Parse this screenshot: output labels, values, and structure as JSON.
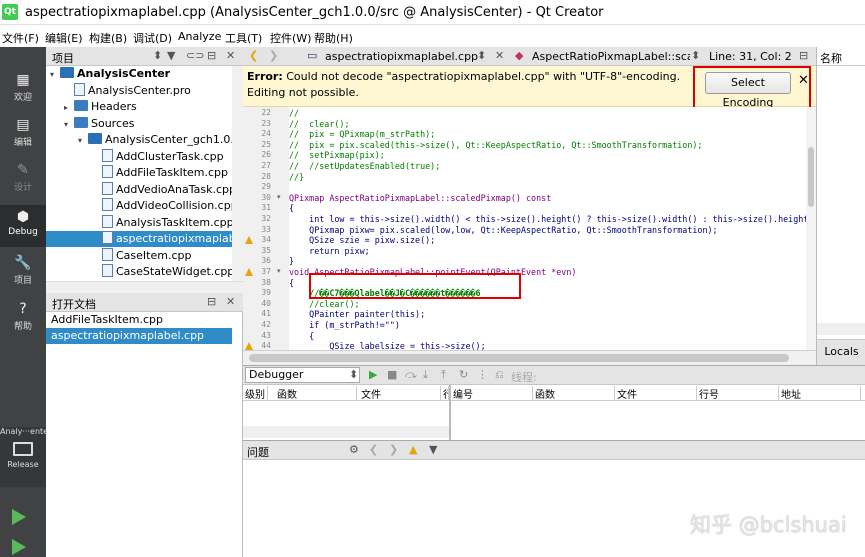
{
  "window": {
    "title": "aspectratiopixmaplabel.cpp (AnalysisCenter_gch1.0.0/src @ AnalysisCenter) - Qt Creator",
    "qt_logo": "Qt"
  },
  "menu": [
    "文件(F)",
    "编辑(E)",
    "构建(B)",
    "调试(D)",
    "Analyze",
    "工具(T)",
    "控件(W)",
    "帮助(H)"
  ],
  "modes": [
    {
      "label": "欢迎",
      "icon": "welcome-icon",
      "glyph": "▦"
    },
    {
      "label": "编辑",
      "icon": "edit-icon",
      "glyph": "▤"
    },
    {
      "label": "设计",
      "icon": "design-icon",
      "glyph": "✎"
    },
    {
      "label": "Debug",
      "icon": "debug-icon",
      "glyph": "⬢"
    },
    {
      "label": "项目",
      "icon": "projects-icon",
      "glyph": "🔧"
    },
    {
      "label": "帮助",
      "icon": "help-icon",
      "glyph": "?"
    }
  ],
  "kit": {
    "project": "Analy···enter",
    "config": "Release",
    "run_icon": "run-icon",
    "debug_run_icon": "debug-run-icon"
  },
  "project_pane": {
    "title": "项目",
    "tree": [
      {
        "label": "AnalysisCenter",
        "depth": 0,
        "kind": "project",
        "arrow": "▾"
      },
      {
        "label": "AnalysisCenter.pro",
        "depth": 1,
        "kind": "file",
        "arrow": ""
      },
      {
        "label": "Headers",
        "depth": 1,
        "kind": "folder",
        "arrow": "▸"
      },
      {
        "label": "Sources",
        "depth": 1,
        "kind": "folder",
        "arrow": "▾"
      },
      {
        "label": "AnalysisCenter_gch1.0.0/s",
        "depth": 2,
        "kind": "project",
        "arrow": "▾"
      },
      {
        "label": "AddClusterTask.cpp",
        "depth": 3,
        "kind": "file",
        "arrow": ""
      },
      {
        "label": "AddFileTaskItem.cpp",
        "depth": 3,
        "kind": "file",
        "arrow": ""
      },
      {
        "label": "AddVedioAnaTask.cpp",
        "depth": 3,
        "kind": "file",
        "arrow": ""
      },
      {
        "label": "AddVideoCollision.cpp",
        "depth": 3,
        "kind": "file",
        "arrow": ""
      },
      {
        "label": "AnalysisTaskItem.cpp",
        "depth": 3,
        "kind": "file",
        "arrow": ""
      },
      {
        "label": "aspectratiopixmaplabe",
        "depth": 3,
        "kind": "file",
        "arrow": "",
        "selected": true
      },
      {
        "label": "CaseItem.cpp",
        "depth": 3,
        "kind": "file",
        "arrow": ""
      },
      {
        "label": "CaseStateWidget.cpp",
        "depth": 3,
        "kind": "file",
        "arrow": ""
      }
    ]
  },
  "open_docs": {
    "title": "打开文档",
    "items": [
      {
        "label": "AddFileTaskItem.cpp",
        "selected": false
      },
      {
        "label": "aspectratiopixmaplabel.cpp",
        "selected": true
      }
    ]
  },
  "editor_toolbar": {
    "file": "aspectratiopixmaplabel.cpp",
    "symbol": "AspectRatioPixmapLabel::scal···",
    "position": "Line: 31, Col: 2"
  },
  "error_bar": {
    "prefix": "Error:",
    "message": "Could not decode \"aspectratiopixmaplabel.cpp\" with \"UTF-8\"-encoding. Editing not possible.",
    "button": "Select Encoding",
    "close": "✕"
  },
  "code_lines": [
    {
      "n": "22",
      "t": "//"
    },
    {
      "n": "23",
      "t": "//  clear();"
    },
    {
      "n": "24",
      "t": "//  pix = QPixmap(m_strPath);"
    },
    {
      "n": "25",
      "t": "//  pix = pix.scaled(this->size(), Qt::KeepAspectRatio, Qt::SmoothTransformation);"
    },
    {
      "n": "26",
      "t": "//  setPixmap(pix);"
    },
    {
      "n": "27",
      "t": "//  //setUpdatesEnabled(true);"
    },
    {
      "n": "28",
      "t": "//}"
    },
    {
      "n": "29",
      "t": ""
    },
    {
      "n": "30",
      "t": "QPixmap AspectRatioPixmapLabel::scaledPixmap() const",
      "fold": true
    },
    {
      "n": "31",
      "t": "{"
    },
    {
      "n": "32",
      "t": "    int low = this->size().width() < this->size().height() ? this->size().width() : this->size().height();"
    },
    {
      "n": "33",
      "t": "    QPixmap pixw= pix.scaled(low,low, Qt::KeepAspectRatio, Qt::SmoothTransformation);"
    },
    {
      "n": "34",
      "t": "    QSize szie = pixw.size();",
      "warn": true
    },
    {
      "n": "35",
      "t": "    return pixw;"
    },
    {
      "n": "36",
      "t": "}"
    },
    {
      "n": "37",
      "t": "void AspectRatioPixmapLabel::pointEvent(QPaintEvent *evn)",
      "fold": true,
      "warn": true
    },
    {
      "n": "38",
      "t": "{"
    },
    {
      "n": "39",
      "t": "    //��C7���Qlabel��J�C������t������6",
      "garbled": true
    },
    {
      "n": "40",
      "t": "    //clear();"
    },
    {
      "n": "41",
      "t": "    QPainter painter(this);"
    },
    {
      "n": "42",
      "t": "    if (m_strPath!=\"\")"
    },
    {
      "n": "43",
      "t": "    {"
    },
    {
      "n": "44",
      "t": "        QSize labelsize = this->size();",
      "warn": true
    },
    {
      "n": "45",
      "t": "        ..."
    }
  ],
  "right_pane": {
    "title": "名称",
    "footer": "Locals"
  },
  "debugger": {
    "title": "Debugger",
    "threads": "线程:",
    "cols_left": [
      "级别",
      "函数",
      "文件",
      "行"
    ],
    "cols_right": [
      "编号",
      "函数",
      "文件",
      "行号",
      "地址"
    ]
  },
  "issues": {
    "title": "问题"
  },
  "watermark": "知乎 @bclshuai",
  "colors": {
    "sidebar": "#404244",
    "selection": "#308cc6",
    "error_bg": "#fff7d1",
    "annotation": "#e00000"
  }
}
